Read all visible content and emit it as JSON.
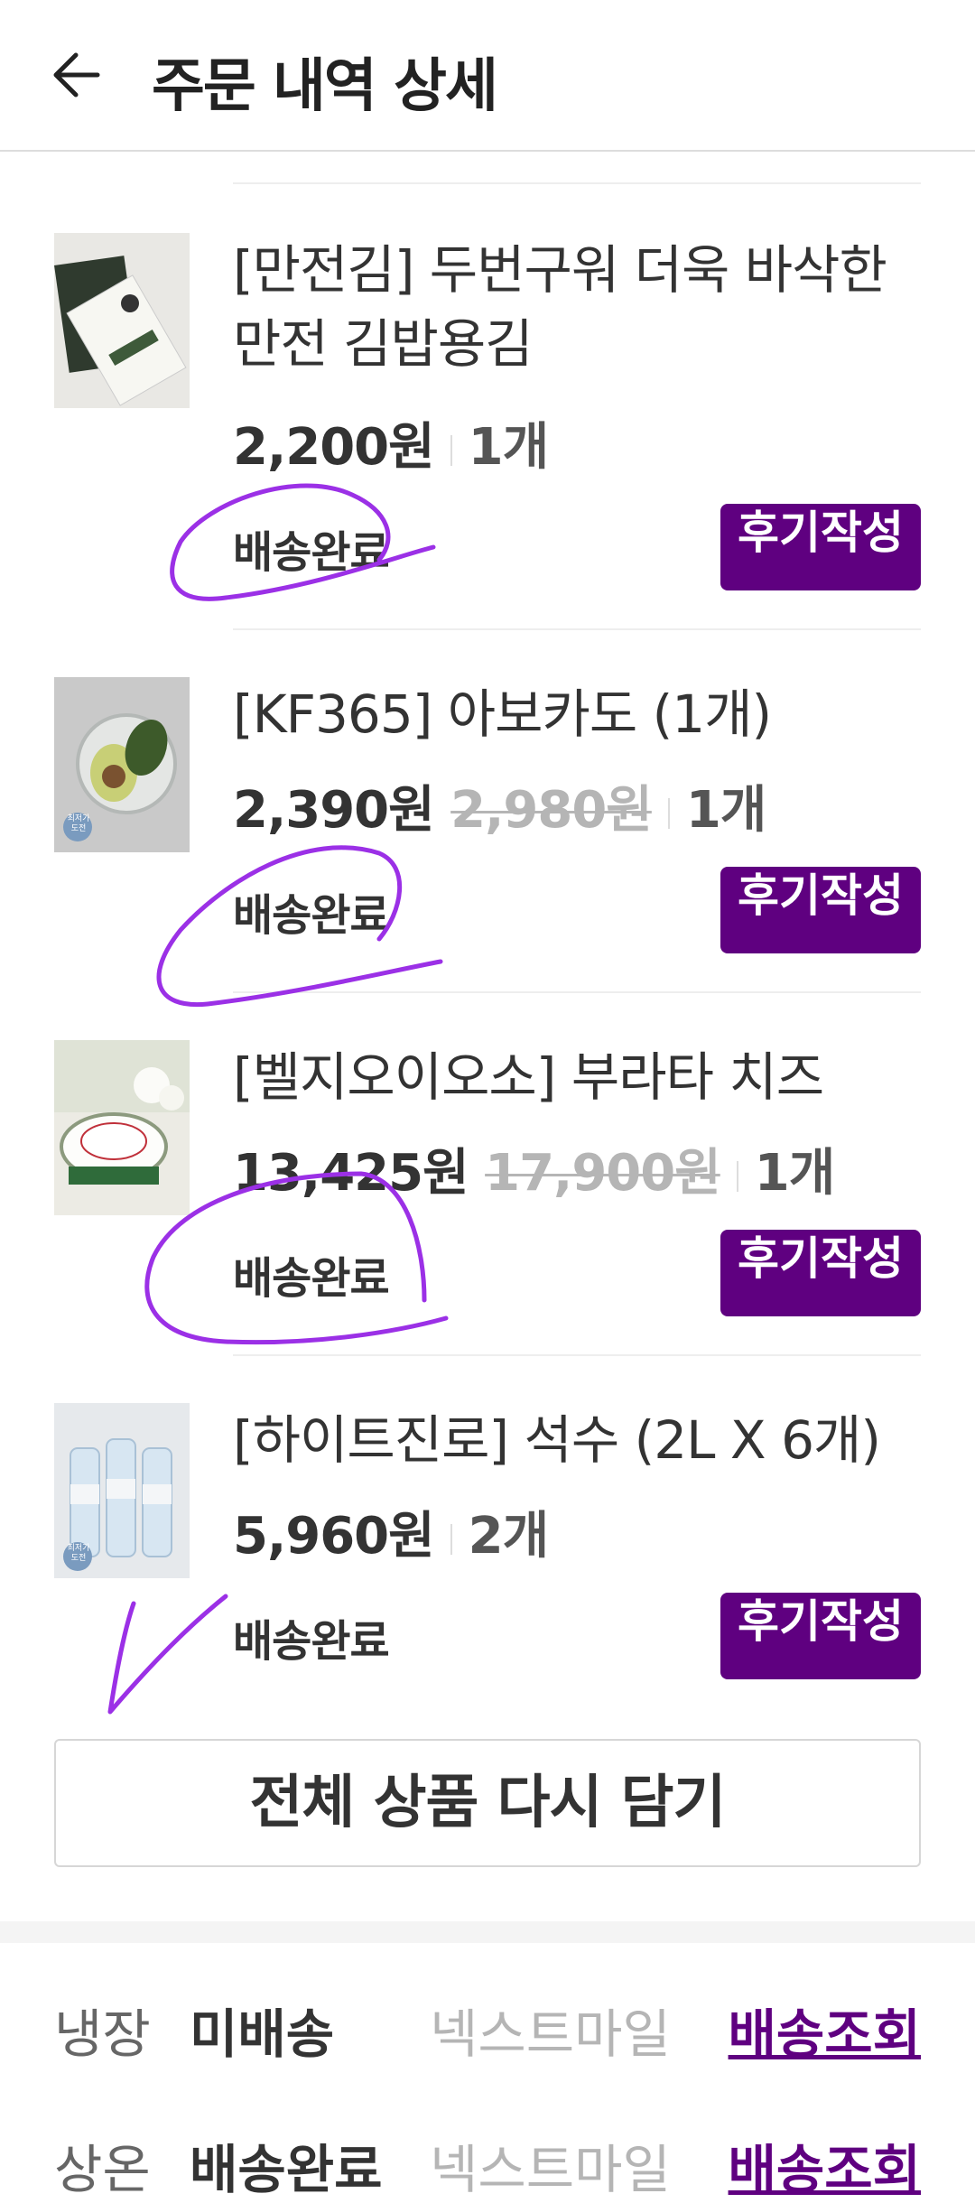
{
  "header": {
    "title": "주문 내역 상세",
    "back_icon": "arrow-left-icon"
  },
  "items": [
    {
      "name": "[만전김] 두번구워 더욱 바삭한 만전 김밥용김",
      "price": "2,200원",
      "original_price": "",
      "quantity": "1개",
      "status": "배송완료",
      "review_label": "후기작성"
    },
    {
      "name": "[KF365] 아보카도 (1개)",
      "price": "2,390원",
      "original_price": "2,980원",
      "quantity": "1개",
      "status": "배송완료",
      "review_label": "후기작성",
      "badge": "최저가 도전"
    },
    {
      "name": "[벨지오이오소] 부라타 치즈",
      "price": "13,425원",
      "original_price": "17,900원",
      "quantity": "1개",
      "status": "배송완료",
      "review_label": "후기작성"
    },
    {
      "name": "[하이트진로] 석수 (2L X 6개)",
      "price": "5,960원",
      "original_price": "",
      "quantity": "2개",
      "status": "배송완료",
      "review_label": "후기작성",
      "badge": "최저가 도전"
    }
  ],
  "reorder_button": "전체 상품 다시 담기",
  "shipping": [
    {
      "type": "냉장",
      "status": "미배송",
      "carrier": "넥스트마일",
      "track_label": "배송조회"
    },
    {
      "type": "상온",
      "status": "배송완료",
      "carrier": "넥스트마일",
      "track_label": "배송조회"
    }
  ],
  "colors": {
    "accent": "#5f0080",
    "annotation": "#9b30e6"
  }
}
